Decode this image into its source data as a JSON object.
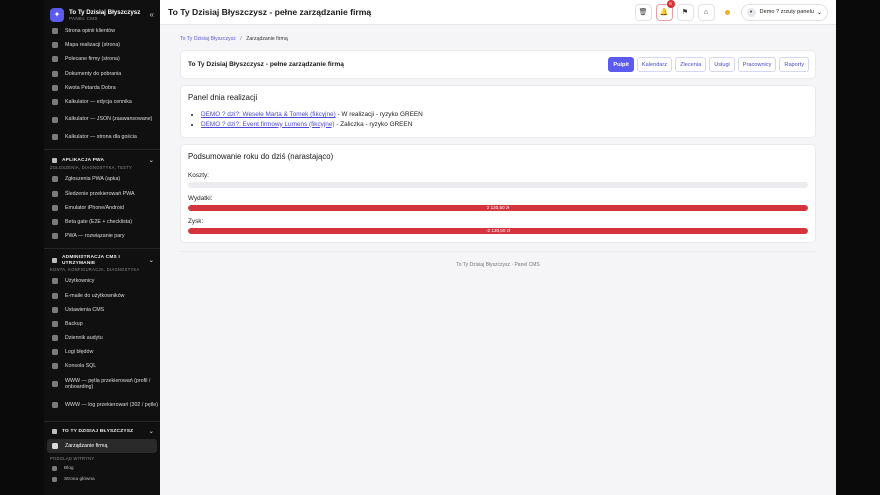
{
  "brand": {
    "title": "To Ty Dzisiaj Błyszczysz",
    "subtitle": "PANEL CMS",
    "collapse_icon": "double-chevron-left-icon"
  },
  "nav_top": [
    {
      "label": "Strona opinii klientów"
    },
    {
      "label": "Mapa realizacji (strona)"
    },
    {
      "label": "Polecane firmy (strona)"
    },
    {
      "label": "Dokumenty do pobrania"
    },
    {
      "label": "Kwota Petarda Dobra"
    },
    {
      "label": "Kalkulator — edycja cennika"
    },
    {
      "label": "Kalkulator — JSON (zaawansowane)"
    },
    {
      "label": "Kalkulator — strona dla gościa"
    }
  ],
  "section_pwa": {
    "title": "APLIKACJA PWA",
    "subtitle": "ZGŁOSZENIA, DIAGNOSTYKA, TESTY"
  },
  "nav_pwa": [
    {
      "label": "Zgłoszenia PWA (apka)"
    },
    {
      "label": "Śledzenie przekierowań PWA"
    },
    {
      "label": "Emulator iPhone/Android"
    },
    {
      "label": "Beta gate (E2E + checklista)"
    },
    {
      "label": "PWA — rozwiązanie pary"
    }
  ],
  "section_admin": {
    "title": "ADMINISTRACJA CMS I UTRZYMANIE",
    "subtitle": "KONTA, KONFIGURACJA, DIAGNOSTYKA"
  },
  "nav_admin": [
    {
      "label": "Użytkownicy"
    },
    {
      "label": "E-maile do użytkowników"
    },
    {
      "label": "Ustawienia CMS"
    },
    {
      "label": "Backup"
    },
    {
      "label": "Dziennik audytu"
    },
    {
      "label": "Logi błędów"
    },
    {
      "label": "Konsola SQL"
    },
    {
      "label": "WWW — pętla przekierowań (profil / onboarding)"
    },
    {
      "label": "WWW — log przekierowań (302 / pętle)"
    }
  ],
  "section_company": {
    "title": "TO TY DZISIAJ BŁYSZCZYSZ"
  },
  "nav_company_active": {
    "label": "Zarządzanie firmą"
  },
  "section_public": {
    "subtitle": "PODGLĄD WITRYNY"
  },
  "nav_public": [
    {
      "label": "Blog"
    },
    {
      "label": "Strona główna"
    }
  ],
  "topbar": {
    "title": "To Ty Dzisiaj Błyszczysz - pełne zarządzanie firmą",
    "notif_count": "6",
    "user_label": "Demo ? zrzuty panelu"
  },
  "breadcrumb": {
    "home": "To Ty Dzisiaj Błyszczysz",
    "sep": "/",
    "current": "Zarządzanie firmą"
  },
  "header_card": {
    "title": "To Ty Dzisiaj Błyszczysz - pełne zarządzanie firmą",
    "tabs": [
      "Pulpit",
      "Kalendarz",
      "Zlecenia",
      "Usługi",
      "Pracownicy",
      "Raporty"
    ]
  },
  "daily": {
    "title": "Panel dnia realizacji",
    "items": [
      {
        "link": "DEMO ? dzi?: Wesele Marta & Tomek (fikcyjne)",
        "rest": " - W realizacji - ryzyko GREEN"
      },
      {
        "link": "DEMO ? dzi?: Event firmowy Lumens (fikcyjne)",
        "rest": " - Zaliczka - ryzyko GREEN"
      }
    ]
  },
  "summary": {
    "title": "Podsumowanie roku do dziś (narastająco)",
    "costs_label": "Koszty:",
    "expenses_label": "Wydatki:",
    "expenses_value": "2 130,50 zł",
    "expenses_fill": 1.0,
    "profit_label": "Zysk:",
    "profit_value": "-2 130,50 zł",
    "profit_fill": 1.0,
    "costs_fill": 0.0
  },
  "footer": {
    "text": "To Ty Dzisiaj Błyszczysz · Panel CMS"
  },
  "colors": {
    "accent": "#5b5bf0",
    "danger": "#d5343f",
    "sidebar_bg": "#101010"
  }
}
